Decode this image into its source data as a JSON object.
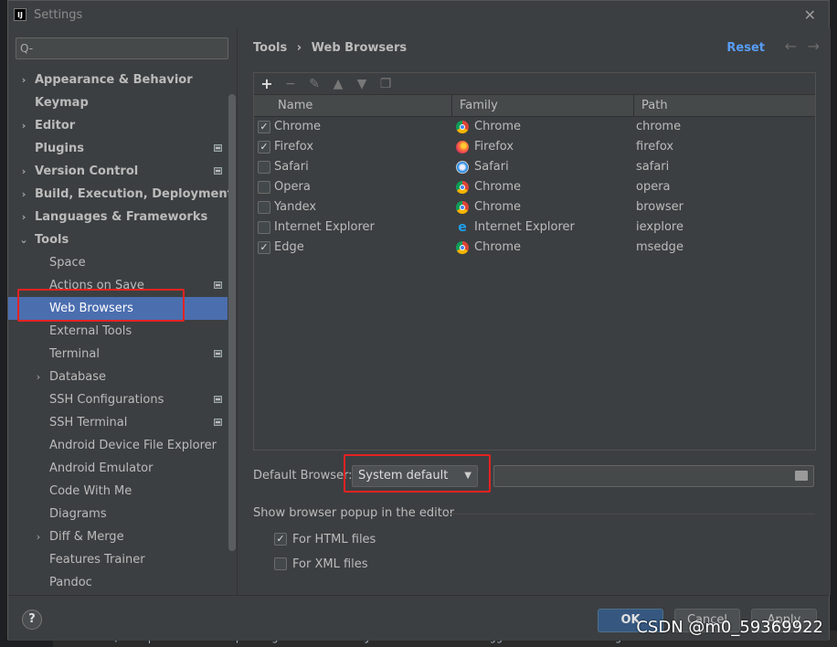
{
  "window": {
    "title": "Settings"
  },
  "search": {
    "placeholder": "Q-"
  },
  "sidebar": {
    "items": [
      {
        "label": "Appearance & Behavior",
        "level": 0,
        "bold": true,
        "arrow": "right",
        "badge": false
      },
      {
        "label": "Keymap",
        "level": 0,
        "bold": true,
        "arrow": "",
        "badge": false
      },
      {
        "label": "Editor",
        "level": 0,
        "bold": true,
        "arrow": "right",
        "badge": false
      },
      {
        "label": "Plugins",
        "level": 0,
        "bold": true,
        "arrow": "",
        "badge": true
      },
      {
        "label": "Version Control",
        "level": 0,
        "bold": true,
        "arrow": "right",
        "badge": true
      },
      {
        "label": "Build, Execution, Deployment",
        "level": 0,
        "bold": true,
        "arrow": "right",
        "badge": false
      },
      {
        "label": "Languages & Frameworks",
        "level": 0,
        "bold": true,
        "arrow": "right",
        "badge": false
      },
      {
        "label": "Tools",
        "level": 0,
        "bold": true,
        "arrow": "down",
        "badge": false
      },
      {
        "label": "Space",
        "level": 1,
        "bold": false,
        "arrow": "",
        "badge": false
      },
      {
        "label": "Actions on Save",
        "level": 1,
        "bold": false,
        "arrow": "",
        "badge": true
      },
      {
        "label": "Web Browsers",
        "level": 1,
        "bold": false,
        "arrow": "",
        "badge": false,
        "selected": true
      },
      {
        "label": "External Tools",
        "level": 1,
        "bold": false,
        "arrow": "",
        "badge": false
      },
      {
        "label": "Terminal",
        "level": 1,
        "bold": false,
        "arrow": "",
        "badge": true
      },
      {
        "label": "Database",
        "level": 1,
        "bold": false,
        "arrow": "right",
        "badge": false
      },
      {
        "label": "SSH Configurations",
        "level": 1,
        "bold": false,
        "arrow": "",
        "badge": true
      },
      {
        "label": "SSH Terminal",
        "level": 1,
        "bold": false,
        "arrow": "",
        "badge": true
      },
      {
        "label": "Android Device File Explorer",
        "level": 1,
        "bold": false,
        "arrow": "",
        "badge": false
      },
      {
        "label": "Android Emulator",
        "level": 1,
        "bold": false,
        "arrow": "",
        "badge": false
      },
      {
        "label": "Code With Me",
        "level": 1,
        "bold": false,
        "arrow": "",
        "badge": false
      },
      {
        "label": "Diagrams",
        "level": 1,
        "bold": false,
        "arrow": "",
        "badge": false
      },
      {
        "label": "Diff & Merge",
        "level": 1,
        "bold": false,
        "arrow": "right",
        "badge": false
      },
      {
        "label": "Features Trainer",
        "level": 1,
        "bold": false,
        "arrow": "",
        "badge": false
      },
      {
        "label": "Pandoc",
        "level": 1,
        "bold": false,
        "arrow": "",
        "badge": false
      }
    ]
  },
  "header": {
    "crumb_parent": "Tools",
    "crumb_sep": "›",
    "crumb_current": "Web Browsers",
    "reset_label": "Reset"
  },
  "table": {
    "columns": [
      "Name",
      "Family",
      "Path"
    ],
    "rows": [
      {
        "checked": true,
        "name": "Chrome",
        "family": "Chrome",
        "family_icon": "chrome",
        "path": "chrome"
      },
      {
        "checked": true,
        "name": "Firefox",
        "family": "Firefox",
        "family_icon": "firefox",
        "path": "firefox"
      },
      {
        "checked": false,
        "name": "Safari",
        "family": "Safari",
        "family_icon": "safari",
        "path": "safari"
      },
      {
        "checked": false,
        "name": "Opera",
        "family": "Chrome",
        "family_icon": "chrome",
        "path": "opera"
      },
      {
        "checked": false,
        "name": "Yandex",
        "family": "Chrome",
        "family_icon": "chrome",
        "path": "browser"
      },
      {
        "checked": false,
        "name": "Internet Explorer",
        "family": "Internet Explorer",
        "family_icon": "ie",
        "path": "iexplore"
      },
      {
        "checked": true,
        "name": "Edge",
        "family": "Chrome",
        "family_icon": "chrome",
        "path": "msedge"
      }
    ]
  },
  "default_browser": {
    "label": "Default Browser:",
    "selected": "System default",
    "path_value": ""
  },
  "popup": {
    "label": "Show browser popup in the editor",
    "html_label": "For HTML files",
    "html_checked": true,
    "xml_label": "For XML files",
    "xml_checked": false
  },
  "footer": {
    "ok_label": "OK",
    "cancel_label": "Cancel",
    "apply_label": "Apply",
    "help_label": "?"
  },
  "background": {
    "log_text": "16:00:01,804 | INFO in ch.qos.logback.classic.joran.action.RootLoggerAction - Setting level of ROOT"
  },
  "watermark": "CSDN @m0_59369922",
  "colors": {
    "selection": "#4b6eaf",
    "accent_link": "#589df6",
    "highlight_box": "#e52222",
    "primary_button": "#365880"
  }
}
